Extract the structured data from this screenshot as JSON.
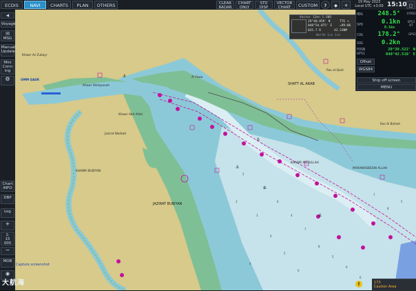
{
  "topbar": {
    "ecdis": "ECDIS",
    "navi": "NAVI",
    "charts": "CHARTS",
    "plan": "PLAN",
    "others": "OTHERS",
    "clear_radar": [
      "CLEAR",
      "RADAR"
    ],
    "chart_only": [
      "CHART",
      "ONLY"
    ],
    "std_disp": [
      "STD",
      "DISP"
    ],
    "vector_chart": [
      "VECTOR",
      "CHART"
    ],
    "custom": "CUSTOM",
    "date": "19 May 2023",
    "local_utc": "Local UTC +3:00",
    "time": "15:10"
  },
  "sidebar": {
    "voyage": "Voyage",
    "msg": "MSG",
    "manual_update": [
      "Manual",
      "Update"
    ],
    "mini_conning": [
      "Mini",
      "Conn",
      "ing"
    ],
    "chart_info": [
      "Chart",
      "INFO"
    ],
    "dbp": "DBP",
    "log": "Log",
    "scale": [
      "1:",
      "15",
      "000"
    ],
    "mob": "MOB"
  },
  "info_panel": {
    "hdg_label": "HDG",
    "hdg_value": "248.5°",
    "hdg_source": "GYRO1",
    "spd_label": "SPD",
    "spd_value": "0.1kn",
    "spd_sub": "0.1kn",
    "spd_source": "GPS1 BT",
    "cog_label": "COG",
    "cog_value": "178.2°",
    "cog_source": "GPS1",
    "sog_label": "SOG",
    "sog_value": "0.2kn",
    "posn_label": "POSN",
    "posn_sub": "GPS1",
    "lat": "29°39.522' N",
    "lon": "048°42.518' E",
    "offset": "Offset",
    "datum": "WGS84",
    "ship_off_screen": "Ship off screen",
    "menu": "MENU"
  },
  "cursor_overlay": {
    "title": "Vector 12mn 1 GND",
    "lat": "29°40.859' N",
    "lon": "048°54.075' E",
    "tte": "TTG +",
    "brg_rng_a": "=99:06",
    "brg": "025.7 R",
    "rng": "42.31NM",
    "note": "North 1in 1in"
  },
  "places": {
    "umm_qasr": "UMM QASR",
    "khawr_az_zubayr": "Khawr Az Zubayr",
    "khawr_shitayanah": "Khawr Shitayanah",
    "khawr_abd_allah": "Khawr Abd Allah",
    "shatt_al_arab": "SHATT AL ARAB",
    "al_fawo": "Al Fawo",
    "jaziat_bubiyan": "JAZIRAT BUBIYAN",
    "khawr_bubiyan": "KHAWR BUBIYAN",
    "marakkisbesin": "MARAKKISBESIN ALLAH",
    "ras_al_bisheh": "Ras Al Bisheh",
    "khawr_abdullah_channel": "KHAWR ABDULLAH",
    "shatt_al_arab_2": "SHATT AL ARAB",
    "warbah": "Jazirat Warbah",
    "ras_al_qaid": "Ras al-Qaid"
  },
  "status": {
    "caption": "Capture screenshot",
    "caution": "Caution Area",
    "caution_count": "173",
    "watermark": "大航海"
  },
  "colors": {
    "land": "#d7ca8a",
    "shallow": "#8cc9d8",
    "deep": "#c6e2ea",
    "intertidal": "#7fbf96",
    "active": "#2a90c8",
    "readout": "#33e04a"
  }
}
